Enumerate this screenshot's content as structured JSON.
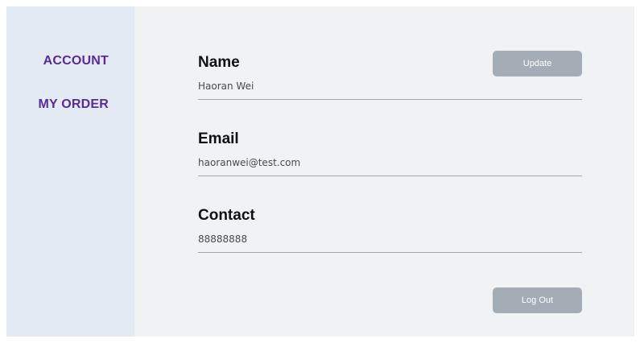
{
  "sidebar": {
    "items": [
      {
        "label": "ACCOUNT"
      },
      {
        "label": "MY ORDER"
      }
    ]
  },
  "profile": {
    "name": {
      "label": "Name",
      "value": "Haoran Wei"
    },
    "email": {
      "label": "Email",
      "value": "haoranwei@test.com"
    },
    "contact": {
      "label": "Contact",
      "value": "88888888"
    }
  },
  "actions": {
    "update_label": "Update",
    "logout_label": "Log Out"
  },
  "colors": {
    "sidebar_bg": "#e4eaf4",
    "main_bg": "#f1f2f4",
    "nav_text": "#5a2b92",
    "button_bg": "#a4acb6",
    "divider": "#a3a8af"
  }
}
